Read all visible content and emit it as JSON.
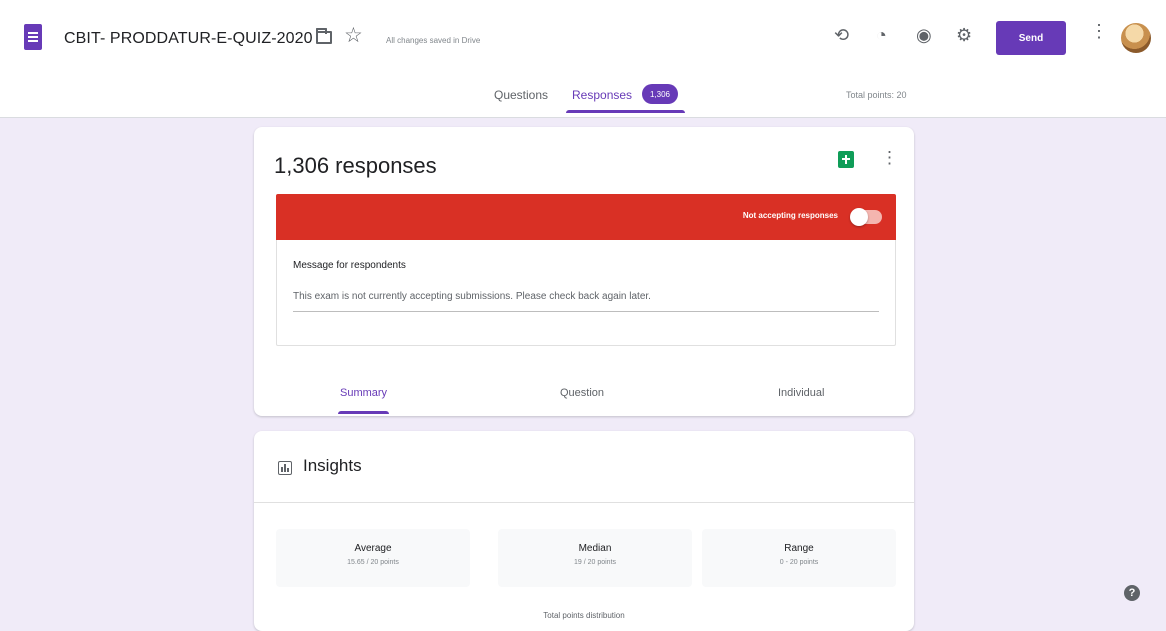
{
  "header": {
    "doc_title": "CBIT- PRODDATUR-E-QUIZ-2020",
    "saved_status": "All changes saved in Drive",
    "send_label": "Send",
    "icons": [
      "addon-puzzle-icon",
      "palette-icon",
      "eye-preview-icon",
      "settings-gear-icon",
      "more-vert-icon"
    ]
  },
  "tabs": {
    "questions": "Questions",
    "responses": "Responses",
    "responses_count": "1,306",
    "total_points": "Total points: 20"
  },
  "responses_card": {
    "title": "1,306 responses",
    "banner_text": "Not accepting responses",
    "accepting": false,
    "message_label": "Message for respondents",
    "message_text": "This exam is not currently accepting submissions. Please check back again later.",
    "subtabs": [
      "Summary",
      "Question",
      "Individual"
    ],
    "active_subtab": "Summary"
  },
  "insights": {
    "title": "Insights",
    "stats": [
      {
        "label": "Average",
        "value": "15.65 / 20 points"
      },
      {
        "label": "Median",
        "value": "19 / 20 points"
      },
      {
        "label": "Range",
        "value": "0 - 20 points"
      }
    ],
    "distribution_label": "Total points distribution"
  },
  "colors": {
    "accent": "#673ab7",
    "banner": "#d93025",
    "background": "#f0ebf8",
    "sheets": "#0f9d58"
  }
}
